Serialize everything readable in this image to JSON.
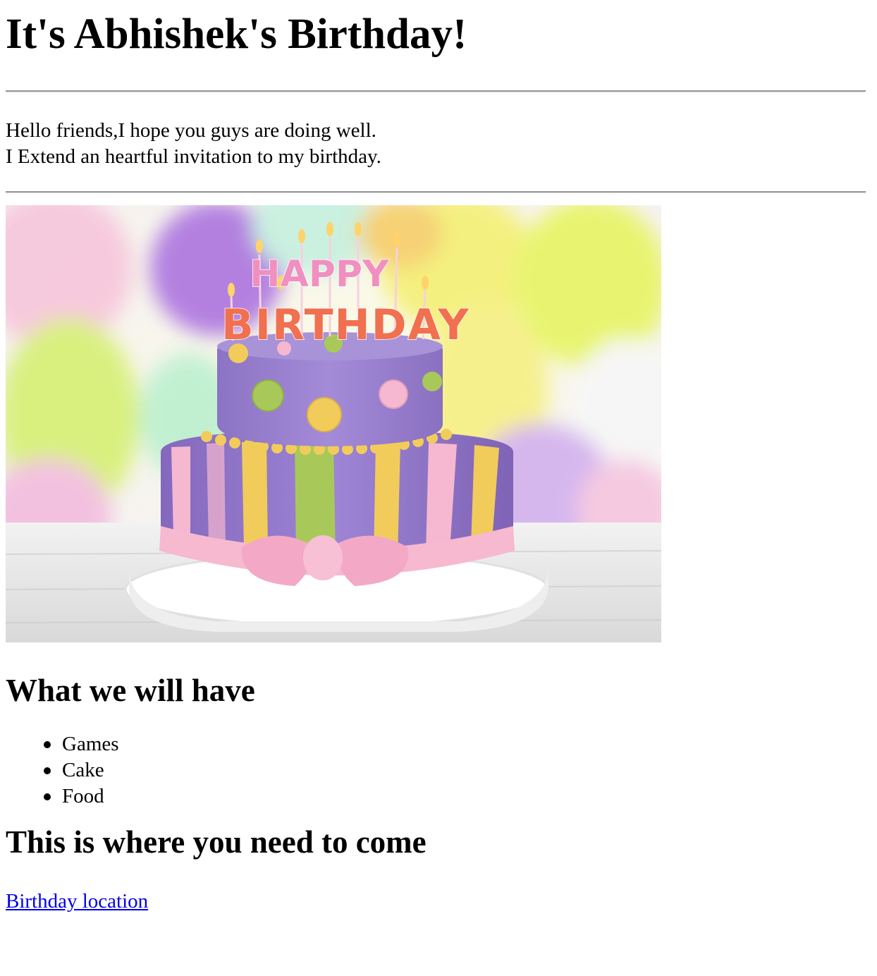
{
  "page": {
    "title": "It's Abhishek's Birthday!",
    "intro_line1": "Hello friends,I hope you guys are doing well.",
    "intro_line2": "I Extend an heartful invitation to my birthday.",
    "image": {
      "icon": "birthday-cake-image",
      "candles_text_top": "HAPPY",
      "candles_text_bottom": "BIRTHDAY"
    },
    "have_heading": "What we will have",
    "have_items": [
      "Games",
      "Cake",
      "Food"
    ],
    "come_heading": "This is where you need to come",
    "location_link": "Birthday location"
  },
  "colors": {
    "link": "#0000ee",
    "rule": "#999999",
    "cake_purple": "#9a7fd1",
    "cake_pink": "#f5b8d0",
    "cake_yellow": "#f2cc5a",
    "cake_green": "#a8c95a"
  }
}
